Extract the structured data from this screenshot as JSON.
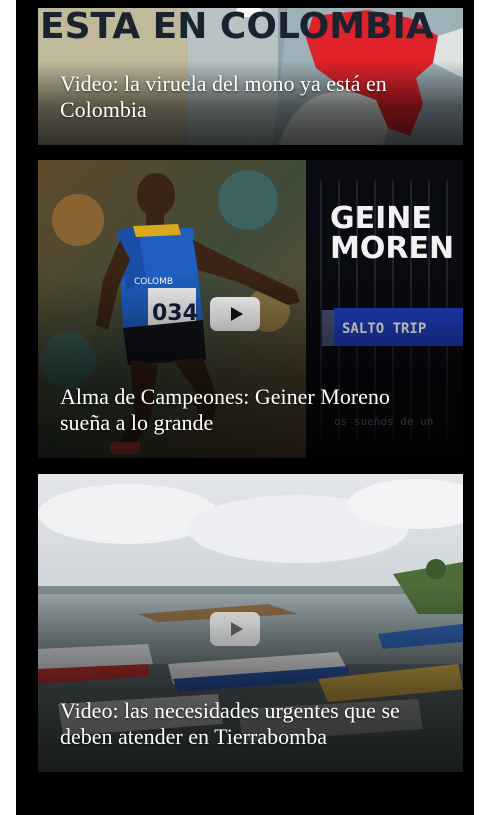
{
  "videos": [
    {
      "title": "Video: la viruela del mono ya está en Colombia",
      "thumbnail_text": "ESTA EN COLOMBIA"
    },
    {
      "title": "Alma de Campeones: Geiner Moreno sueña a lo grande",
      "thumbnail_text_top": "GEINE",
      "thumbnail_text_bottom": "MOREN",
      "thumbnail_banner": "SALTO TRIP",
      "thumbnail_caption": "os sueños de un",
      "bib_number": "034",
      "shirt_text": "COLOMB"
    },
    {
      "title": "Video: las necesidades urgentes que se deben atender en Tierrabomba"
    }
  ],
  "colors": {
    "background": "#000000",
    "map_red": "#e0232a",
    "banner_blue": "#1f3fbf"
  },
  "icons": [
    "play-icon"
  ]
}
